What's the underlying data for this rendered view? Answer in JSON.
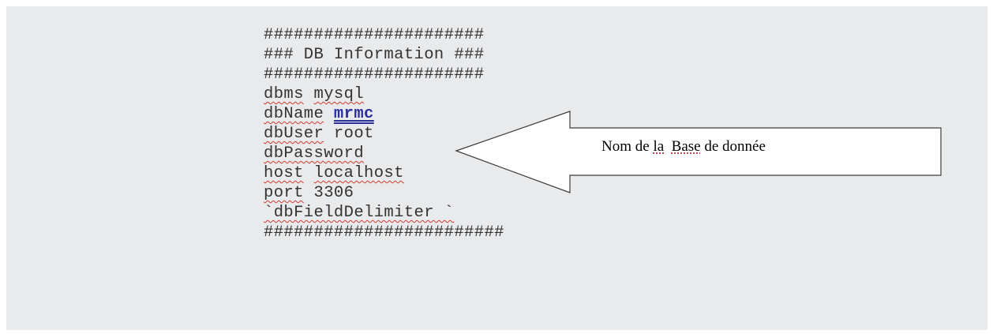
{
  "config": {
    "header_border_top": "######################",
    "header_title": "### DB Information ###",
    "header_border_bottom": "######################",
    "dbms_key": "dbms",
    "dbms_value": "mysql",
    "dbname_key": "dbName",
    "dbname_value": "mrmc",
    "dbuser_key": "dbUser",
    "dbuser_value": "root",
    "dbpassword_key": "dbPassword",
    "host_key": "host",
    "host_value": "localhost",
    "port_key": "port",
    "port_value": "3306",
    "delimiter_line": "`dbFieldDelimiter `",
    "footer_border": "########################"
  },
  "callout": {
    "part1": "Nom de ",
    "part2": "la",
    "part3": "  ",
    "part4": "Base",
    "part5": " de donnée"
  },
  "colors": {
    "background": "#e9eaec",
    "squiggle": "#d23a2e",
    "link_value": "#2a2f9b"
  }
}
